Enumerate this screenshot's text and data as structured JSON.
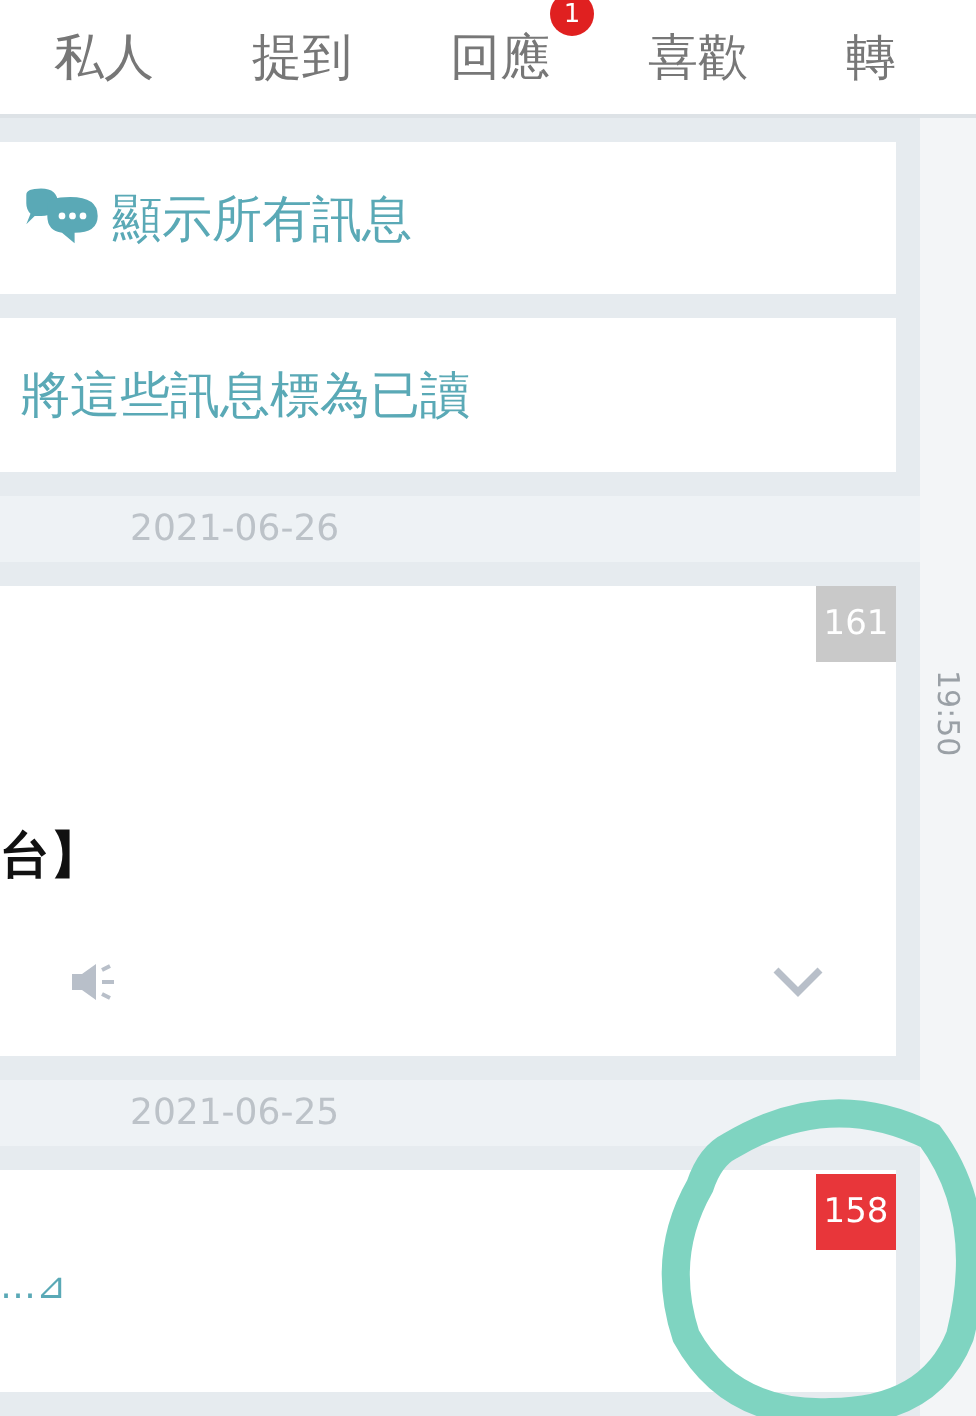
{
  "tabs": [
    {
      "label": "私人"
    },
    {
      "label": "提到"
    },
    {
      "label": "回應",
      "badge": "1"
    },
    {
      "label": "喜歡"
    },
    {
      "label": "轉"
    }
  ],
  "actions": [
    {
      "label": "顯示所有訊息"
    },
    {
      "label": "將這些訊息標為已讀"
    }
  ],
  "feed": [
    {
      "kind": "date",
      "text": "2021-06-26"
    },
    {
      "kind": "post",
      "count": "161",
      "unread": false,
      "text": "台】",
      "link": false,
      "audio": true,
      "expand": true
    },
    {
      "kind": "date",
      "text": "2021-06-25"
    },
    {
      "kind": "post",
      "count": "158",
      "unread": true,
      "text": "…⊿",
      "link": true,
      "audio": false,
      "expand": false
    }
  ],
  "time_rail": [
    {
      "time": "19:50"
    }
  ]
}
